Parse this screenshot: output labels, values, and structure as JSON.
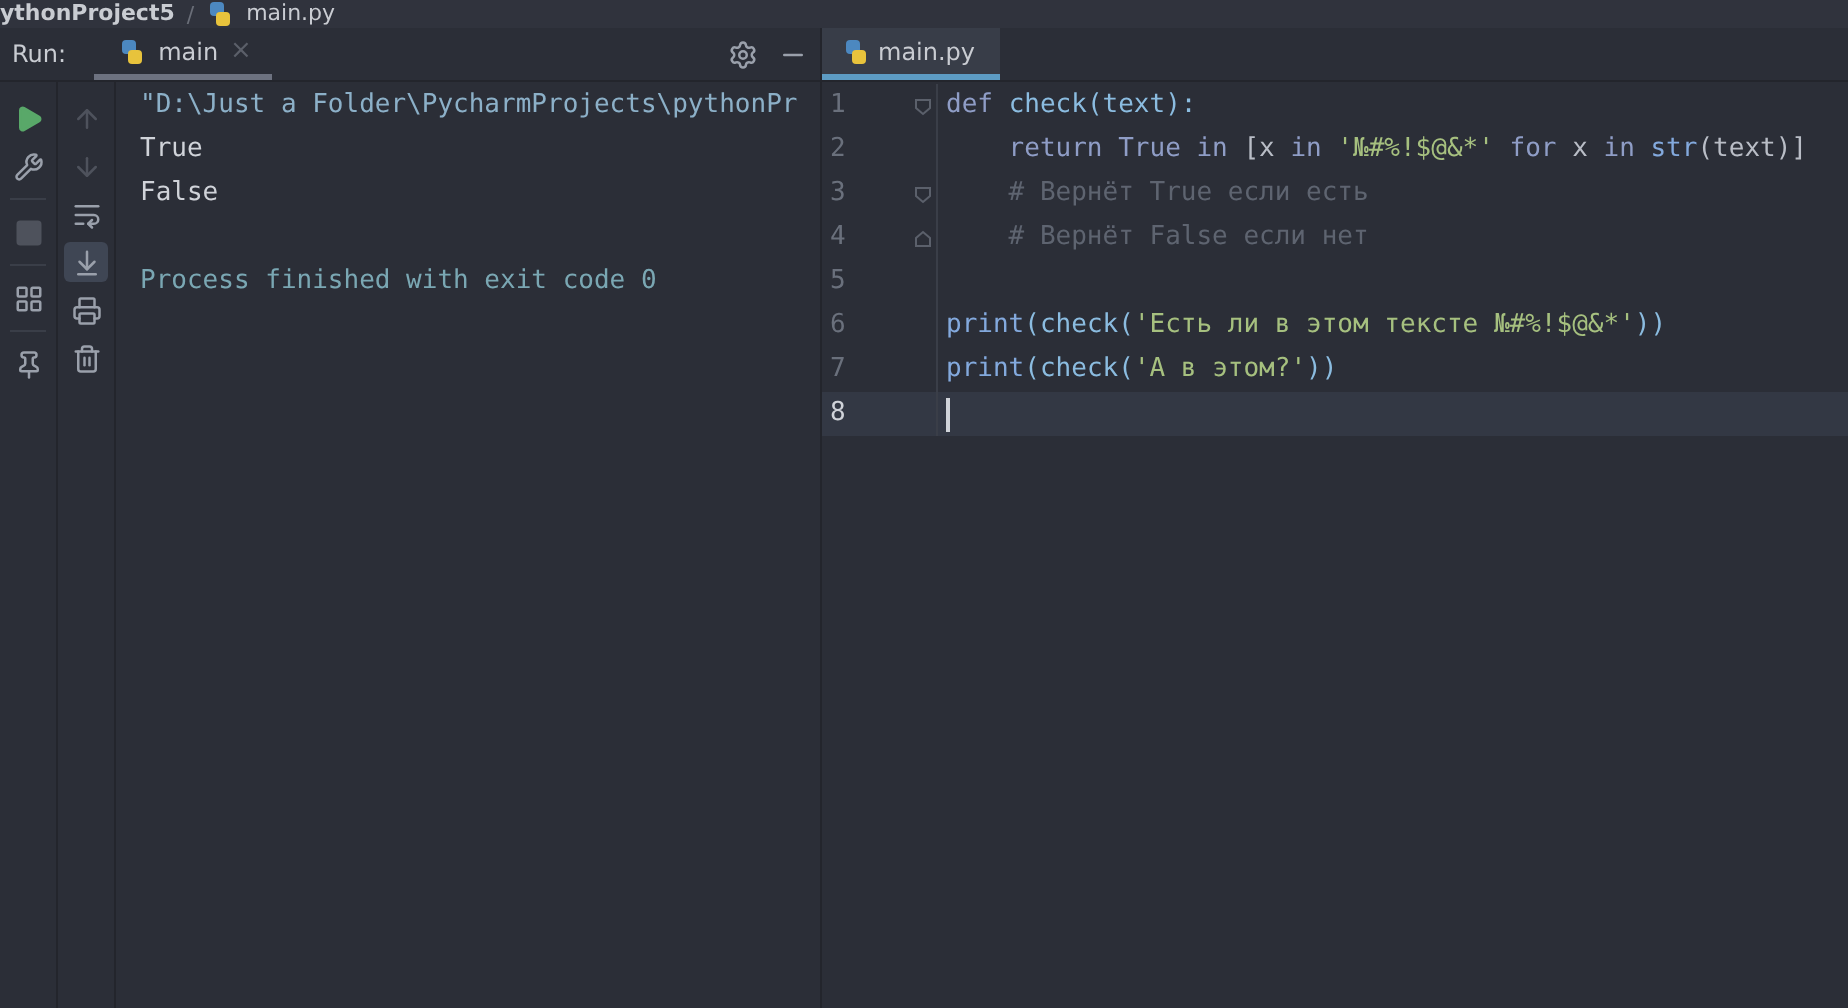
{
  "breadcrumb": {
    "items": [
      "ythonProject5",
      "main.py"
    ],
    "separator": "/"
  },
  "run_panel": {
    "label": "Run:",
    "tabs": [
      {
        "label": "main",
        "selected": true,
        "close": "×"
      }
    ],
    "left_tools": [
      {
        "kind": "run",
        "disabled": false
      },
      {
        "kind": "build",
        "disabled": false
      },
      {
        "kind": "stop",
        "disabled": true
      },
      {
        "kind": "layout",
        "disabled": false
      },
      {
        "kind": "pin",
        "disabled": false
      }
    ],
    "console_tools": [
      {
        "kind": "up",
        "disabled": true,
        "selected": false
      },
      {
        "kind": "down",
        "disabled": true,
        "selected": false
      },
      {
        "kind": "wrap",
        "disabled": false,
        "selected": false
      },
      {
        "kind": "scroll",
        "disabled": false,
        "selected": true
      },
      {
        "kind": "print",
        "disabled": false,
        "selected": false
      },
      {
        "kind": "trash",
        "disabled": false,
        "selected": false
      }
    ],
    "console": [
      {
        "kind": "command",
        "text": "\"D:\\Just a Folder\\PycharmProjects\\pythonPr"
      },
      {
        "kind": "output",
        "text": "True"
      },
      {
        "kind": "output",
        "text": "False"
      },
      {
        "kind": "blank"
      },
      {
        "kind": "system",
        "text": "Process finished with exit code 0"
      }
    ]
  },
  "editor": {
    "tabs": [
      {
        "label": "main.py",
        "selected": true
      }
    ],
    "lines": [
      {
        "number": "1",
        "fold_start": true,
        "current": false,
        "tokens": [
          {
            "kind": "keyword",
            "text": "def "
          },
          {
            "kind": "func",
            "text": "check(text):"
          }
        ]
      },
      {
        "number": "2",
        "current": false,
        "indented": true,
        "tokens": [
          {
            "kind": "keyword",
            "text": "return True in "
          },
          {
            "kind": "plain",
            "text": "[x "
          },
          {
            "kind": "keyword",
            "text": "in "
          },
          {
            "kind": "string",
            "text": "'№#%!$@&*'"
          },
          {
            "kind": "keyword",
            "text": " for "
          },
          {
            "kind": "plain",
            "text": "x "
          },
          {
            "kind": "keyword",
            "text": "in "
          },
          {
            "kind": "builtin",
            "text": "str"
          },
          {
            "kind": "plain",
            "text": "(text)]"
          }
        ]
      },
      {
        "number": "3",
        "fold_start": true,
        "current": false,
        "indented": true,
        "tokens": [
          {
            "kind": "comment",
            "text": "# Вернёт True если есть"
          }
        ]
      },
      {
        "number": "4",
        "fold_end": true,
        "current": false,
        "indented": true,
        "tokens": [
          {
            "kind": "comment",
            "text": "# Вернёт False если нет"
          }
        ]
      },
      {
        "number": "5",
        "current": false
      },
      {
        "number": "6",
        "current": false,
        "tokens": [
          {
            "kind": "builtin",
            "text": "print"
          },
          {
            "kind": "func",
            "text": "(check("
          },
          {
            "kind": "string",
            "text": "'Есть ли в этом тексте №#%!$@&*'"
          },
          {
            "kind": "func",
            "text": "))"
          }
        ]
      },
      {
        "number": "7",
        "current": false,
        "tokens": [
          {
            "kind": "builtin",
            "text": "print"
          },
          {
            "kind": "func",
            "text": "(check("
          },
          {
            "kind": "string",
            "text": "'А в этом?'"
          },
          {
            "kind": "func",
            "text": "))"
          }
        ]
      },
      {
        "number": "8",
        "current": true
      }
    ]
  }
}
